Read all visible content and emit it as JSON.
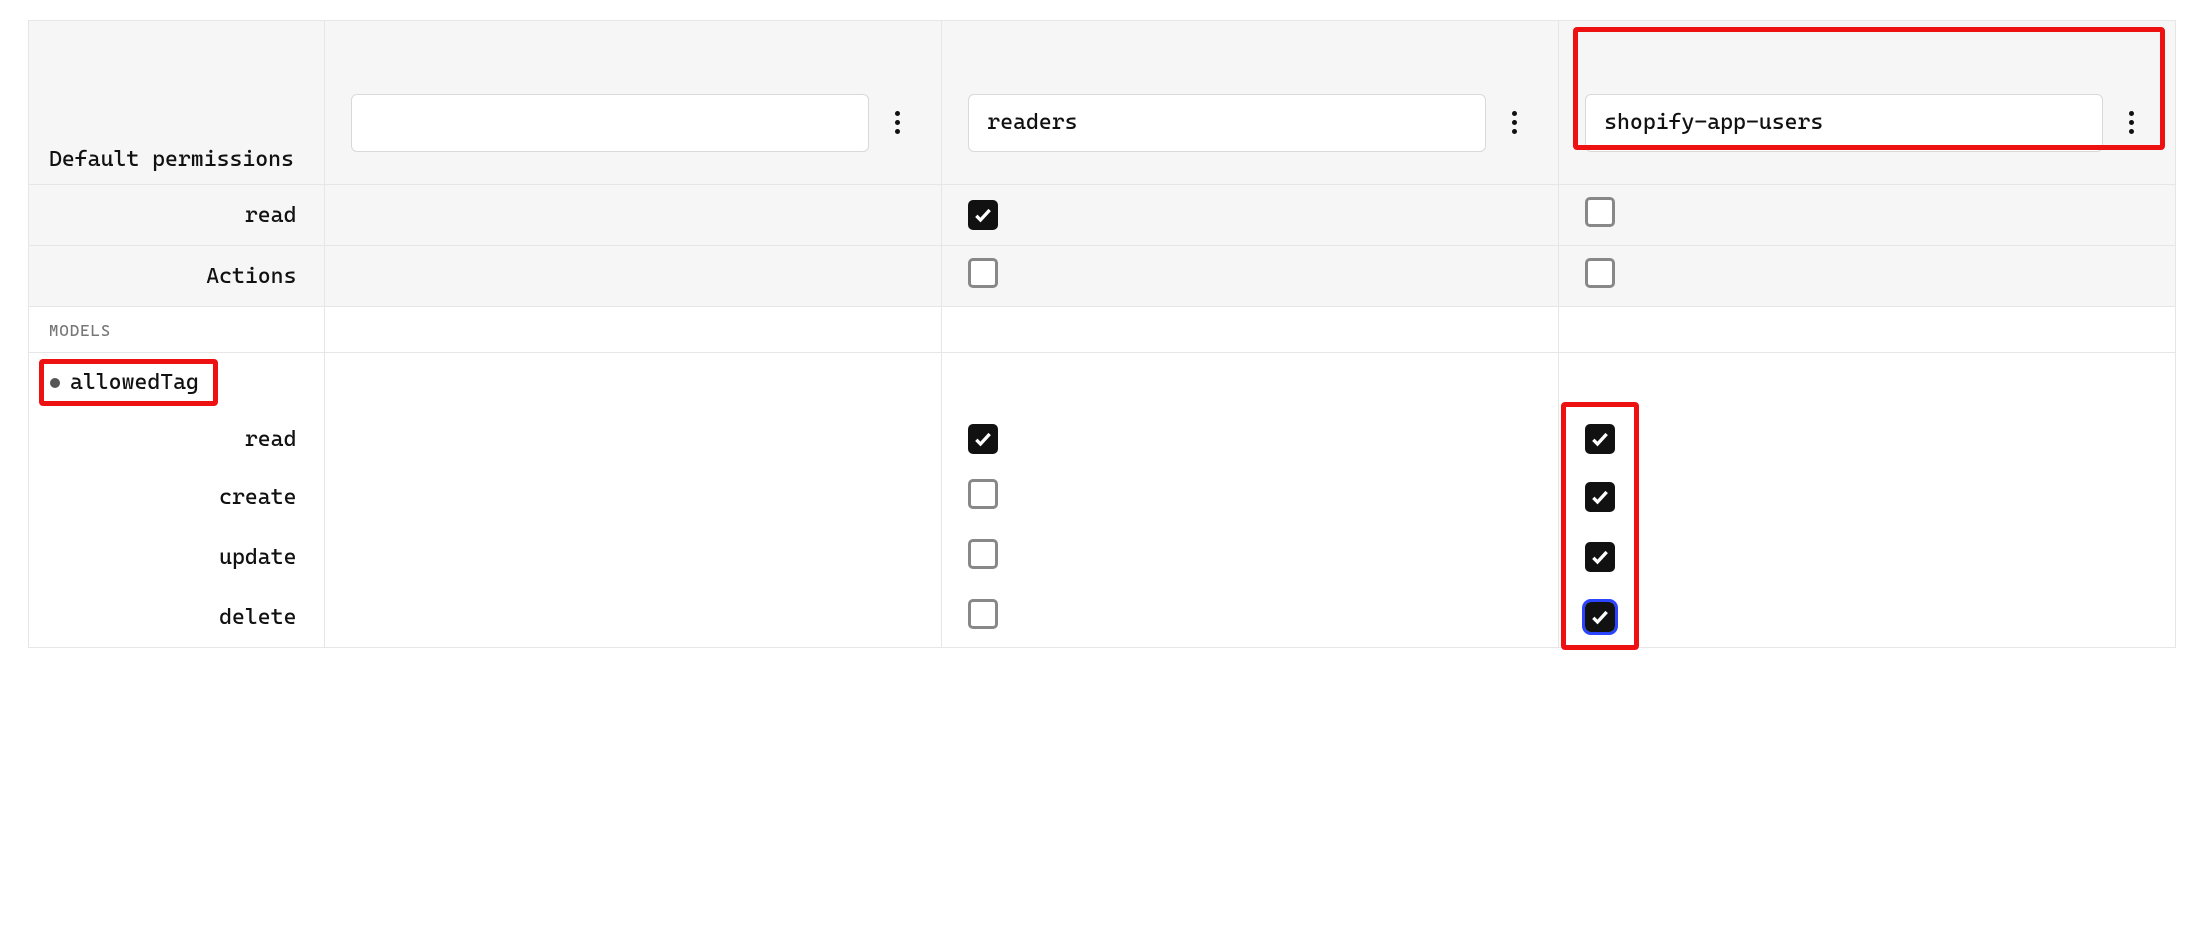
{
  "header": {
    "defaultPermissionsLabel": "Default permissions",
    "roles": [
      {
        "value": ""
      },
      {
        "value": "readers"
      },
      {
        "value": "shopify-app-users",
        "highlighted": true
      }
    ]
  },
  "defaultPermissions": [
    {
      "label": "read",
      "cols": [
        {
          "checked": null
        },
        {
          "checked": true
        },
        {
          "checked": false
        }
      ]
    },
    {
      "label": "Actions",
      "cols": [
        {
          "checked": null
        },
        {
          "checked": false
        },
        {
          "checked": false
        }
      ]
    }
  ],
  "sectionLabel": "MODELS",
  "model": {
    "name": "allowedTag",
    "highlighted": true,
    "permissions": [
      {
        "label": "read",
        "cols": [
          {
            "checked": null
          },
          {
            "checked": true
          },
          {
            "checked": true
          }
        ]
      },
      {
        "label": "create",
        "cols": [
          {
            "checked": null
          },
          {
            "checked": false
          },
          {
            "checked": true
          }
        ]
      },
      {
        "label": "update",
        "cols": [
          {
            "checked": null
          },
          {
            "checked": false
          },
          {
            "checked": true
          }
        ]
      },
      {
        "label": "delete",
        "cols": [
          {
            "checked": null
          },
          {
            "checked": false
          },
          {
            "checked": true,
            "focused": true
          }
        ]
      }
    ],
    "col3Highlighted": true
  },
  "colors": {
    "highlight": "#ee1111",
    "focusRing": "#2a44ff"
  }
}
